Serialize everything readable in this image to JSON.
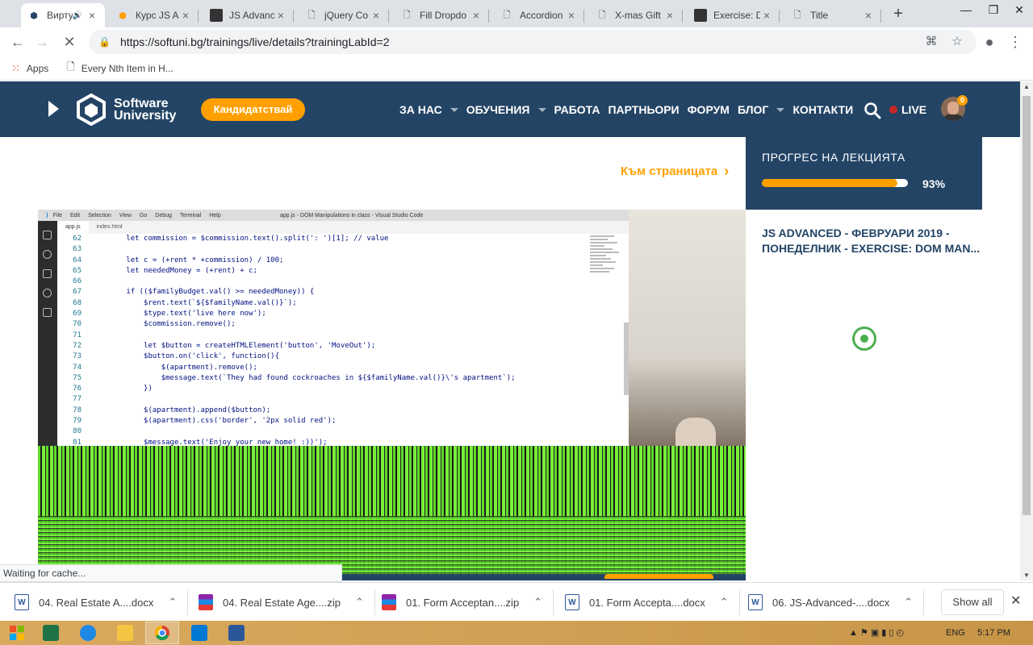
{
  "browser": {
    "tabs": [
      {
        "label": "Виртуална",
        "active": true,
        "favicon": "softuni-icon"
      },
      {
        "label": "Курс JS Ad",
        "favicon": "softuni-orange-icon"
      },
      {
        "label": "JS Advance",
        "favicon": "video-icon"
      },
      {
        "label": "jQuery Co",
        "favicon": "page-icon"
      },
      {
        "label": "Fill Dropdo",
        "favicon": "page-icon"
      },
      {
        "label": "Accordion",
        "favicon": "page-icon"
      },
      {
        "label": "X-mas Gift",
        "favicon": "page-icon"
      },
      {
        "label": "Exercise: D",
        "favicon": "video-icon"
      },
      {
        "label": "Title",
        "favicon": "page-icon"
      }
    ],
    "new_tab": "+",
    "url": "https://softuni.bg/trainings/live/details?trainingLabId=2",
    "bookmarks": [
      {
        "label": "Apps",
        "icon": "apps-grid-icon"
      },
      {
        "label": "Every Nth Item in H...",
        "icon": "page-icon"
      }
    ]
  },
  "site": {
    "logo_line1": "Software",
    "logo_line2": "University",
    "candidate_button": "Кандидатствай",
    "nav": [
      {
        "label": "ЗА НАС",
        "dropdown": true
      },
      {
        "label": "ОБУЧЕНИЯ",
        "dropdown": true
      },
      {
        "label": "РАБОТА",
        "dropdown": false
      },
      {
        "label": "ПАРТНЬОРИ",
        "dropdown": false
      },
      {
        "label": "ФОРУМ",
        "dropdown": false
      },
      {
        "label": "БЛОГ",
        "dropdown": true
      },
      {
        "label": "КОНТАКТИ",
        "dropdown": false
      }
    ],
    "live_label": "LIVE",
    "notification_count": "0",
    "to_page_link": "Към страницата",
    "progress_title": "ПРОГРЕС НА ЛЕКЦИЯТА",
    "progress_percent_text": "93%",
    "progress_value": 0.93,
    "lecture_title": "JS ADVANCED - ФЕВРУАРИ 2019 - ПОНЕДЕЛНИК - EXERCISE: DOM MAN..."
  },
  "video": {
    "vscode_menu": [
      "File",
      "Edit",
      "Selection",
      "View",
      "Go",
      "Debug",
      "Terminal",
      "Help"
    ],
    "vscode_title": "app.js - DOM Manipulations in class - Visual Studio Code",
    "vscode_tabs": [
      "app.js",
      "index.html"
    ],
    "code_lines": [
      {
        "n": "62",
        "t": "        let commission = $commission.text().split(': ')[1]; // value"
      },
      {
        "n": "63",
        "t": ""
      },
      {
        "n": "64",
        "t": "        let c = (+rent * +commission) / 100;"
      },
      {
        "n": "65",
        "t": "        let neededMoney = (+rent) + c;"
      },
      {
        "n": "66",
        "t": ""
      },
      {
        "n": "67",
        "t": "        if (($familyBudget.val() >= neededMoney)) {"
      },
      {
        "n": "68",
        "t": "            $rent.text(`${$familyName.val()}`);"
      },
      {
        "n": "69",
        "t": "            $type.text('live here now');"
      },
      {
        "n": "70",
        "t": "            $commission.remove();"
      },
      {
        "n": "71",
        "t": ""
      },
      {
        "n": "72",
        "t": "            let $button = createHTMLElement('button', 'MoveOut');"
      },
      {
        "n": "73",
        "t": "            $button.on('click', function(){"
      },
      {
        "n": "74",
        "t": "                $(apartment).remove();"
      },
      {
        "n": "75",
        "t": "                $message.text(`They had found cockroaches in ${$familyName.val()}\\'s apartment`);"
      },
      {
        "n": "76",
        "t": "            })"
      },
      {
        "n": "77",
        "t": ""
      },
      {
        "n": "78",
        "t": "            $(apartment).append($button);"
      },
      {
        "n": "79",
        "t": "            $(apartment).css('border', '2px solid red');"
      },
      {
        "n": "80",
        "t": ""
      },
      {
        "n": "81",
        "t": "            $message.text('Enjoy your new home! :))');"
      }
    ]
  },
  "status_text": "Waiting for cache...",
  "downloads": [
    {
      "name": "04. Real Estate A....docx",
      "type": "doc"
    },
    {
      "name": "04. Real Estate Age....zip",
      "type": "zip"
    },
    {
      "name": "01. Form Acceptan....zip",
      "type": "zip"
    },
    {
      "name": "01. Form Accepta....docx",
      "type": "doc"
    },
    {
      "name": "06. JS-Advanced-....docx",
      "type": "doc"
    }
  ],
  "show_all": "Show all",
  "taskbar": {
    "language": "ENG",
    "time": "5:17 PM"
  },
  "colors": {
    "brand_navy": "#234465",
    "brand_orange": "#ffa000"
  }
}
